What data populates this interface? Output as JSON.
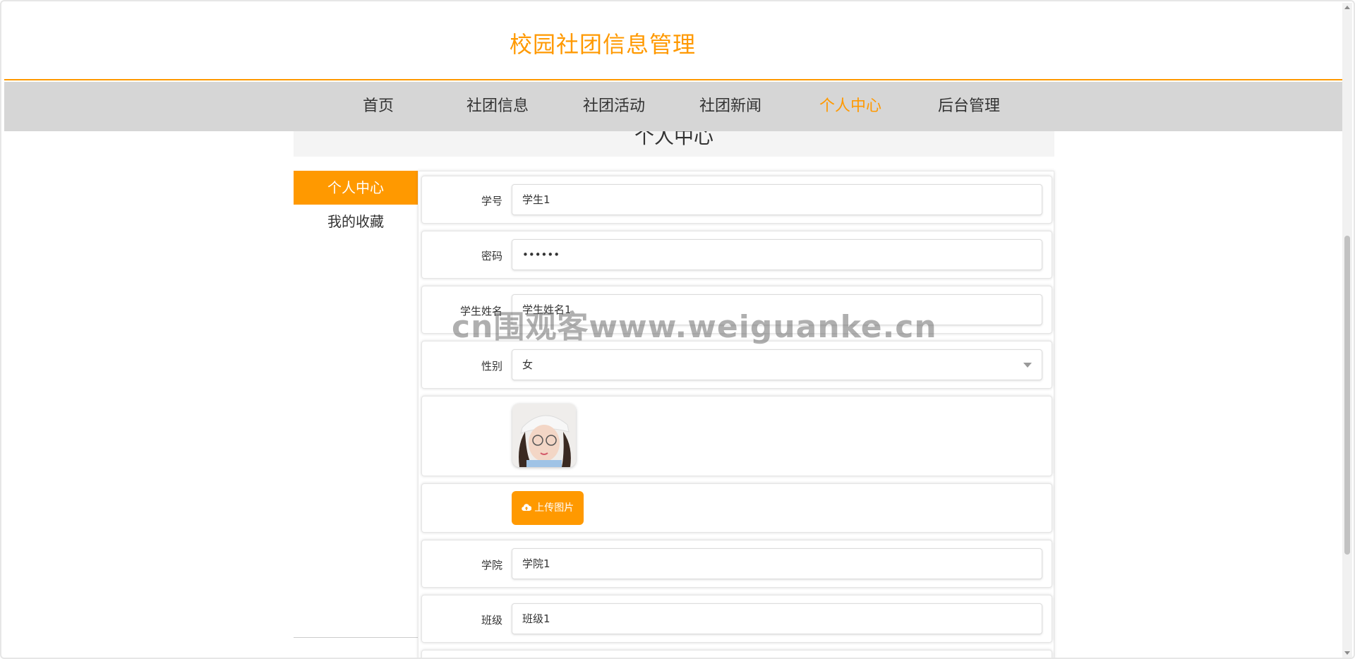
{
  "site": {
    "title": "校园社团信息管理"
  },
  "nav": {
    "items": [
      {
        "label": "首页"
      },
      {
        "label": "社团信息"
      },
      {
        "label": "社团活动"
      },
      {
        "label": "社团新闻"
      },
      {
        "label": "个人中心",
        "active": true
      },
      {
        "label": "后台管理"
      }
    ]
  },
  "section": {
    "title": "个人中心"
  },
  "side_menu": {
    "items": [
      {
        "label": "个人中心",
        "active": true
      },
      {
        "label": "我的收藏"
      }
    ]
  },
  "form": {
    "student_id": {
      "label": "学号",
      "value": "学生1"
    },
    "password": {
      "label": "密码",
      "value": "••••••"
    },
    "name": {
      "label": "学生姓名",
      "value": "学生姓名1"
    },
    "gender": {
      "label": "性别",
      "value": "女"
    },
    "upload": {
      "label": "上传图片"
    },
    "college": {
      "label": "学院",
      "value": "学院1"
    },
    "class": {
      "label": "班级",
      "value": "班级1"
    }
  },
  "watermark": "cn围观客www.weiguanke.cn",
  "colors": {
    "accent": "#ff9900",
    "nav_bg": "#d6d6d6"
  }
}
